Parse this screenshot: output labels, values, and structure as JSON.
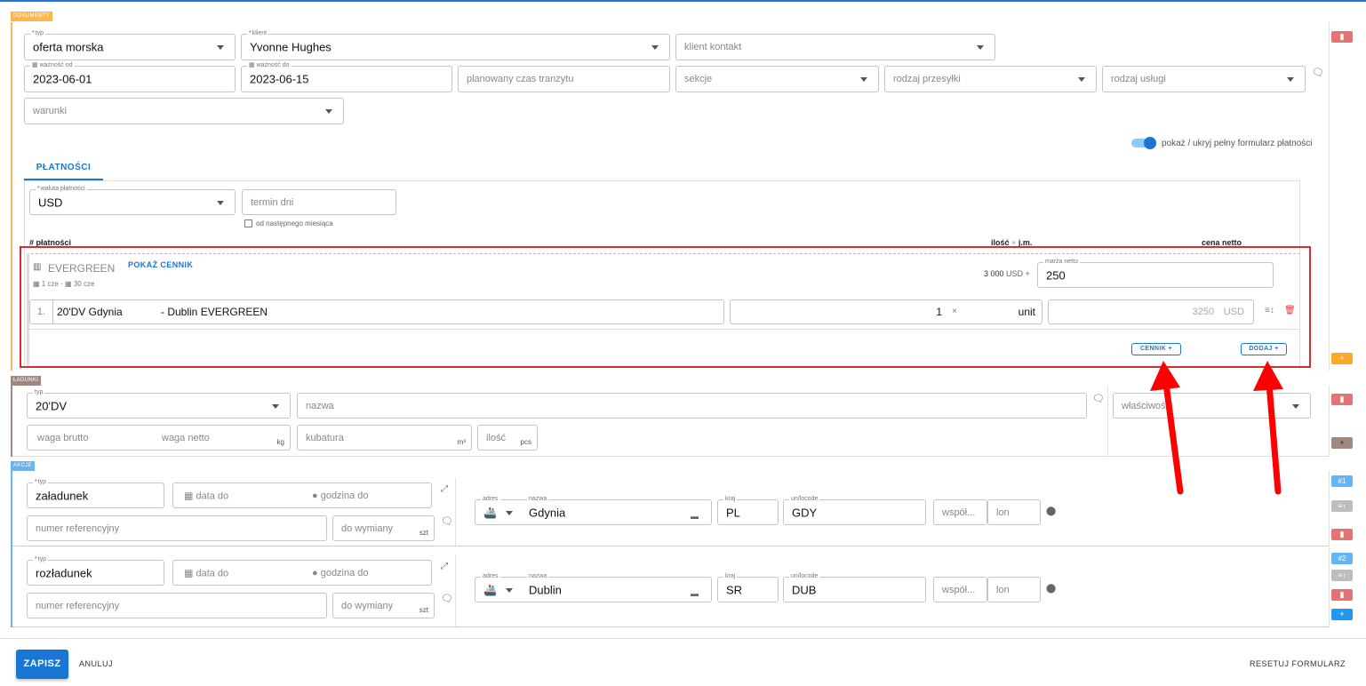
{
  "sections": {
    "dokumenty": "DOKUMENTY",
    "ladunki": "ŁADUNKI",
    "akcje": "AKCJE"
  },
  "doc": {
    "typ_label": "typ",
    "typ_value": "oferta morska",
    "klient_label": "klient",
    "klient_value": "Yvonne Hughes",
    "klient_kontakt_ph": "klient kontakt",
    "waznosc_od_label": "ważność od",
    "waznosc_od_value": "2023-06-01",
    "waznosc_do_label": "ważność do",
    "waznosc_do_value": "2023-06-15",
    "czas_tranzytu_ph": "planowany czas tranzytu",
    "sekcje_ph": "sekcje",
    "rodzaj_przesylki_ph": "rodzaj przesyłki",
    "rodzaj_uslugi_ph": "rodzaj usługi",
    "warunki_ph": "warunki",
    "toggle_label": "pokaż / ukryj pełny formularz płatności",
    "toggle_on": true
  },
  "platnosci": {
    "tab_label": "PŁATNOŚCI",
    "waluta_label": "waluta płatności",
    "waluta_value": "USD",
    "termin_ph": "termin dni",
    "checkbox_label": "od następnego miesiąca",
    "col_hash": "# płatności",
    "col_ilosc": "ilość",
    "col_x": "×",
    "col_jm": "j.m.",
    "col_cena": "cena netto",
    "carrier_name": "EVERGREEN",
    "pokaz_cennik": "POKAŻ CENNIK",
    "info1": "1 cze",
    "info_sep": "-",
    "info2": "30 cze",
    "base_amount": "3 000",
    "base_currency": "USD +",
    "marza_label": "marża netto",
    "marza_value": "250",
    "row_num": "1.",
    "row_desc": "20'DV Gdynia             - Dublin EVERGREEN",
    "row_qty": "1",
    "row_x": "×",
    "row_unit": "unit",
    "row_price": "3250",
    "row_currency": "USD",
    "cennik_btn": "CENNIK +",
    "dodaj_btn": "DODAJ +"
  },
  "ladunki": {
    "typ_label": "typ",
    "typ_value": "20'DV",
    "nazwa_ph": "nazwa",
    "wlasciwosci_ph": "właściwości",
    "waga_brutto_ph": "waga brutto",
    "waga_netto_ph": "waga netto",
    "kg": "kg",
    "kubatura_ph": "kubatura",
    "m3": "m³",
    "ilosc_ph": "ilość",
    "pcs": "pcs"
  },
  "akcje": [
    {
      "typ_label": "typ",
      "typ_value": "załadunek",
      "data_ph": "data do",
      "godzina_ph": "godzina do",
      "ref_ph": "numer referencyjny",
      "wymiana_ph": "do wymiany",
      "szt": "szt",
      "adres_label": "adres",
      "nazwa_label": "nazwa",
      "nazwa_value": "Gdynia",
      "kraj_label": "kraj",
      "kraj_value": "PL",
      "unlocode_label": "un/locode",
      "unlocode_value": "GDY",
      "lat_ph": "współ...",
      "lon_ph": "lon",
      "num": "#1"
    },
    {
      "typ_label": "typ",
      "typ_value": "rozładunek",
      "data_ph": "data do",
      "godzina_ph": "godzina do",
      "ref_ph": "numer referencyjny",
      "wymiana_ph": "do wymiany",
      "szt": "szt",
      "adres_label": "adres",
      "nazwa_label": "nazwa",
      "nazwa_value": "Dublin",
      "kraj_label": "kraj",
      "kraj_value": "SR",
      "unlocode_label": "un/locode",
      "unlocode_value": "DUB",
      "lat_ph": "współ...",
      "lon_ph": "lon",
      "num": "#2"
    }
  ],
  "footer": {
    "zapisz": "ZAPISZ",
    "anuluj": "ANULUJ",
    "resetuj": "RESETUJ FORMULARZ"
  },
  "side": {
    "plus": "+",
    "sort": "≡↕"
  },
  "colors": {
    "primary": "#1976d2",
    "highlight": "#d32f2f",
    "annotation_arrow": "#ff0000",
    "dokumenty_tag": "#ffb74d",
    "ladunki_tag": "#a1887f",
    "akcje_tag": "#64b5f6"
  }
}
